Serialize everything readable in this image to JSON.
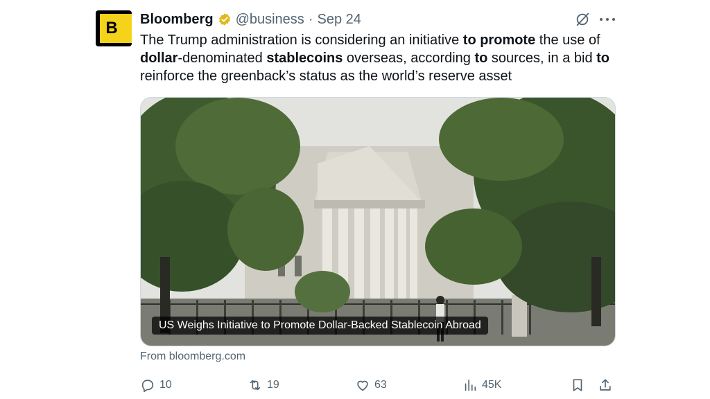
{
  "author": {
    "avatar_letter": "B",
    "name": "Bloomberg",
    "handle": "@business",
    "separator": "·",
    "date": "Sep 24",
    "brand_color": "#f5d31b",
    "verified_color": "#e2b719"
  },
  "tweet": {
    "segments": [
      {
        "text": "The Trump administration is considering an initiative ",
        "bold": false
      },
      {
        "text": "to promote",
        "bold": true
      },
      {
        "text": " the use of ",
        "bold": false
      },
      {
        "text": "dollar",
        "bold": true
      },
      {
        "text": "-denominated ",
        "bold": false
      },
      {
        "text": "stablecoins",
        "bold": true
      },
      {
        "text": " overseas, according ",
        "bold": false
      },
      {
        "text": "to",
        "bold": true
      },
      {
        "text": " sources, in a bid ",
        "bold": false
      },
      {
        "text": "to",
        "bold": true
      },
      {
        "text": " reinforce the greenback’s status as the world’s reserve asset",
        "bold": false
      }
    ]
  },
  "card": {
    "caption": "US Weighs Initiative to Promote Dollar-Backed Stablecoin Abroad",
    "source": "From bloomberg.com"
  },
  "actions": {
    "replies": "10",
    "reposts": "19",
    "likes": "63",
    "views": "45K",
    "icons": [
      "reply-icon",
      "repost-icon",
      "like-icon",
      "views-icon",
      "bookmark-icon",
      "share-icon"
    ]
  },
  "header_icons": [
    "grok-icon",
    "more-icon"
  ]
}
